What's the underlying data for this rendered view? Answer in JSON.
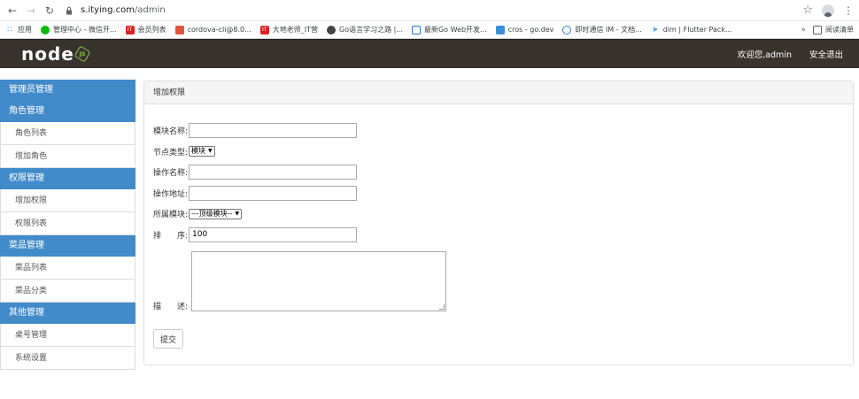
{
  "browser": {
    "url_host": "s.itying.com",
    "url_path": "/admin",
    "bookmarks": [
      {
        "label": "应用",
        "color": "#4285f4"
      },
      {
        "label": "管理中心 - 微信开...",
        "color": "#09bb07"
      },
      {
        "label": "会员列表",
        "color": "#e02020"
      },
      {
        "label": "cordova-cli@8.0...",
        "color": "#e0533c"
      },
      {
        "label": "大地老师_IT营",
        "color": "#e02020"
      },
      {
        "label": "Go语言学习之路 |...",
        "color": "#444444"
      },
      {
        "label": "最新Go Web开发...",
        "color": "#2b73d8"
      },
      {
        "label": "cros - go.dev",
        "color": "#3a8fd6"
      },
      {
        "label": "即时通信 IM - 文档...",
        "color": "#2b7bd8"
      },
      {
        "label": "dim | Flutter Pack...",
        "color": "#42a5f5"
      }
    ],
    "reading_list": "阅读清单"
  },
  "header": {
    "logo_text": "node",
    "logo_badge": "JS",
    "welcome": "欢迎您,admin",
    "logout": "安全退出"
  },
  "sidebar": {
    "groups": [
      {
        "title": "管理员管理",
        "items": []
      },
      {
        "title": "角色管理",
        "items": [
          "角色列表",
          "增加角色"
        ]
      },
      {
        "title": "权限管理",
        "items": [
          "增加权限",
          "权限列表"
        ]
      },
      {
        "title": "菜品管理",
        "items": [
          "菜品列表",
          "菜品分类"
        ]
      },
      {
        "title": "其他管理",
        "items": [
          "桌号管理",
          "系统设置"
        ]
      }
    ]
  },
  "panel": {
    "title": "增加权限",
    "form": {
      "module_name_label": "模块名称:",
      "module_name_value": "",
      "node_type_label": "节点类型:",
      "node_type_value": "模块",
      "action_name_label": "操作名称:",
      "action_name_value": "",
      "action_url_label": "操作地址:",
      "action_url_value": "",
      "parent_module_label": "所属模块:",
      "parent_module_value": "---顶级模块--",
      "sort_label": "排　　序:",
      "sort_value": "100",
      "description_label": "描　　述:",
      "description_value": "",
      "submit_label": "提交"
    }
  }
}
